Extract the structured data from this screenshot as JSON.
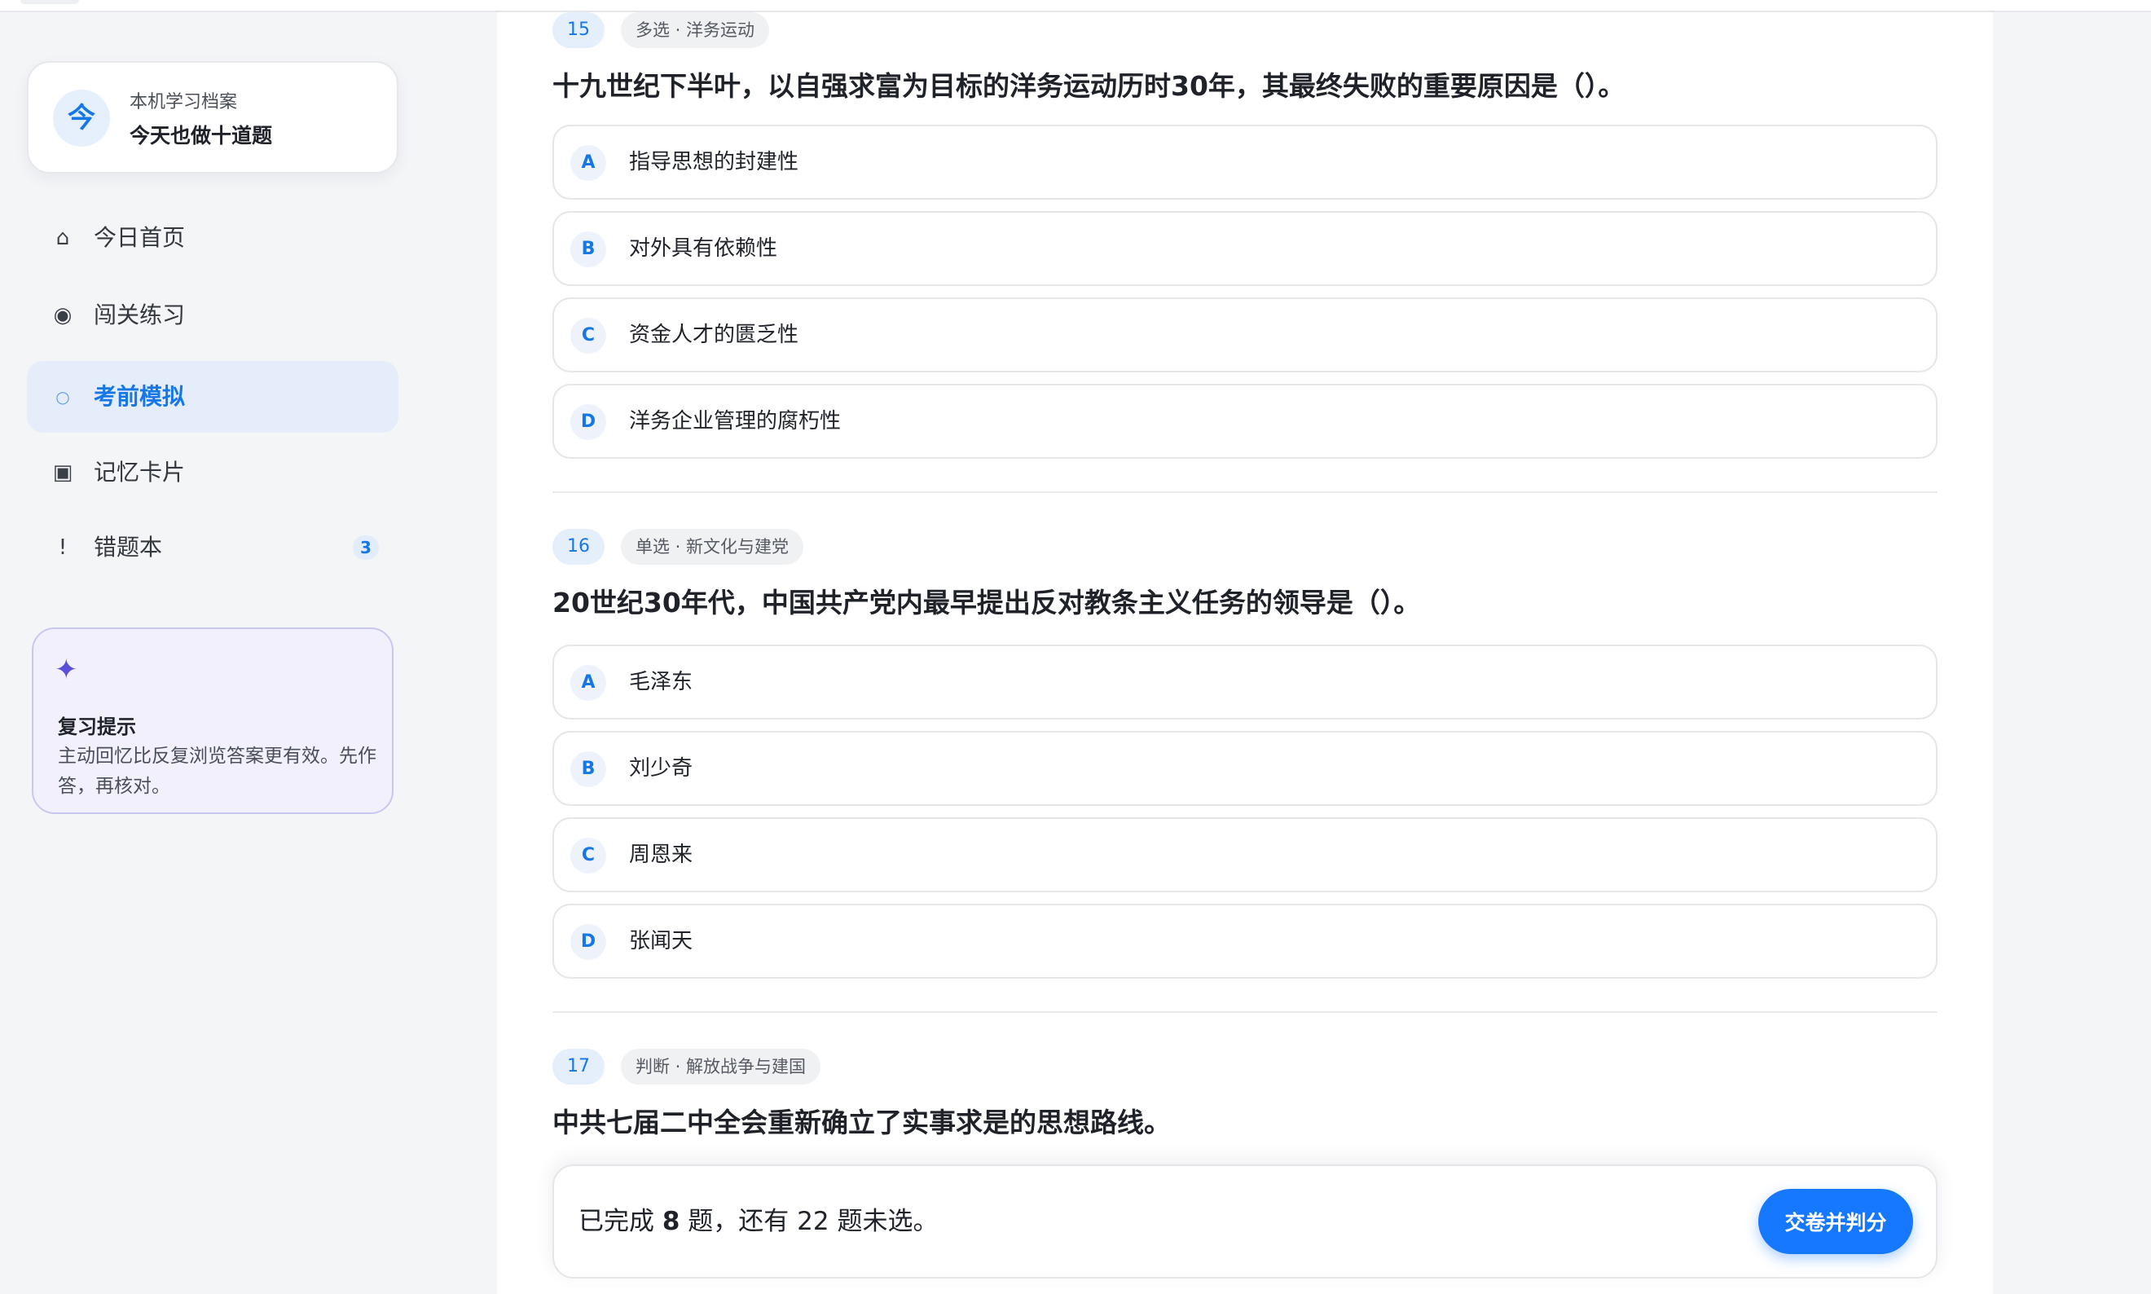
{
  "profile": {
    "avatar": "今",
    "subtitle": "本机学习档案",
    "name": "今天也做十道题"
  },
  "nav": {
    "items": [
      {
        "icon": "⌂",
        "icon_name": "home-icon",
        "label": "今日首页",
        "active": false
      },
      {
        "icon": "◉",
        "icon_name": "target-icon",
        "label": "闯关练习",
        "active": false
      },
      {
        "icon": "○",
        "icon_name": "circle-icon",
        "label": "考前模拟",
        "active": true
      },
      {
        "icon": "▣",
        "icon_name": "card-icon",
        "label": "记忆卡片",
        "active": false
      },
      {
        "icon": "!",
        "icon_name": "exclamation-icon",
        "label": "错题本",
        "active": false,
        "badge": "3"
      }
    ]
  },
  "tip": {
    "icon": "✦",
    "title": "复习提示",
    "text": "主动回忆比反复浏览答案更有效。先作答，再核对。"
  },
  "questions": [
    {
      "num": "15",
      "tag": "多选 · 洋务运动",
      "title": "十九世纪下半叶，以自强求富为目标的洋务运动历时30年，其最终失败的重要原因是（）。",
      "options": [
        {
          "letter": "A",
          "text": "指导思想的封建性"
        },
        {
          "letter": "B",
          "text": "对外具有依赖性"
        },
        {
          "letter": "C",
          "text": "资金人才的匮乏性"
        },
        {
          "letter": "D",
          "text": "洋务企业管理的腐朽性"
        }
      ]
    },
    {
      "num": "16",
      "tag": "单选 · 新文化与建党",
      "title": "20世纪30年代，中国共产党内最早提出反对教条主义任务的领导是（）。",
      "options": [
        {
          "letter": "A",
          "text": "毛泽东"
        },
        {
          "letter": "B",
          "text": "刘少奇"
        },
        {
          "letter": "C",
          "text": "周恩来"
        },
        {
          "letter": "D",
          "text": "张闻天"
        }
      ]
    },
    {
      "num": "17",
      "tag": "判断 · 解放战争与建国",
      "title": "中共七届二中全会重新确立了实事求是的思想路线。",
      "options": []
    }
  ],
  "footer": {
    "prefix": "已完成",
    "done": "8",
    "middle": "题，还有",
    "remaining": "22",
    "suffix": "题未选。",
    "submit_label": "交卷并判分"
  }
}
